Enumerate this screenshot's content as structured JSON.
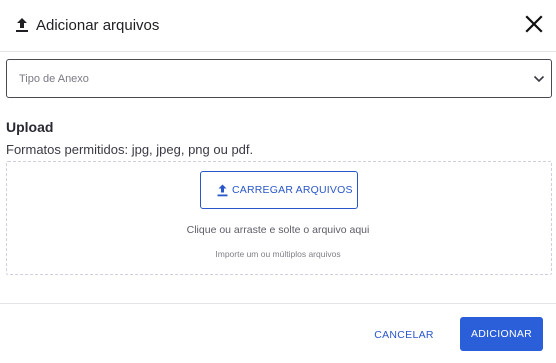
{
  "dialog": {
    "title": "Adicionar arquivos",
    "header_icon": "upload-icon",
    "close_icon": "close-icon"
  },
  "attachment_type": {
    "placeholder": "Tipo de Anexo",
    "value": "",
    "icon": "chevron-down-icon"
  },
  "upload": {
    "title": "Upload",
    "formats_text": "Formatos permitidos: jpg, jpeg, png ou pdf.",
    "button_label": "CARREGAR ARQUIVOS",
    "button_icon": "upload-icon",
    "hint_main": "Clique ou arraste e solte o arquivo aqui",
    "hint_sub": "Importe um ou múltiplos arquivos"
  },
  "footer": {
    "cancel_label": "CANCELAR",
    "add_label": "ADICIONAR"
  },
  "colors": {
    "accent": "#2b5fd9",
    "text": "#1f1f24",
    "border": "#4a4a52",
    "dropzone_border": "#cfcfe0"
  }
}
